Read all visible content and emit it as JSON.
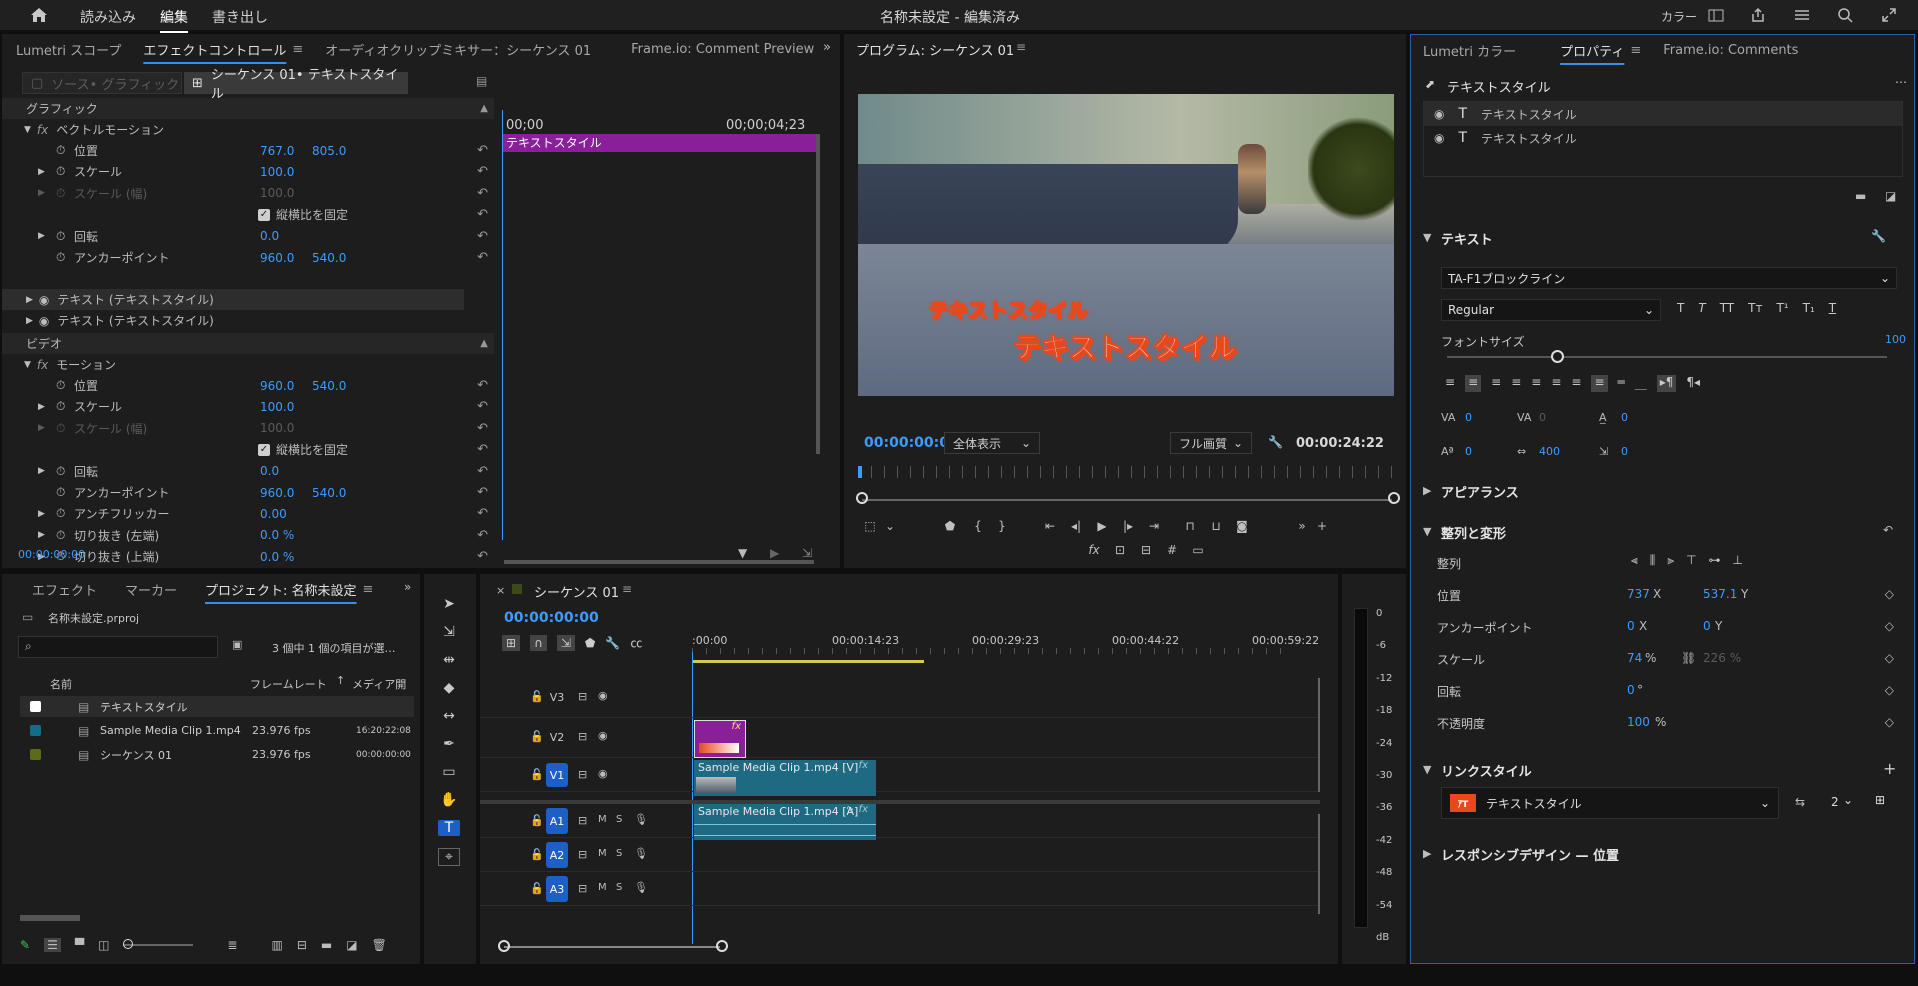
{
  "topbar": {
    "home_label": "",
    "menu": [
      "読み込み",
      "編集",
      "書き出し"
    ],
    "active_menu": 1,
    "title": "名称未設定 - 編集済み",
    "workspace_label": "カラー"
  },
  "effect_panel": {
    "tabs": [
      "Lumetri スコープ",
      "エフェクトコントロール",
      "オーディオクリップミキサー：シーケンス 01",
      "Frame.io: Comment Preview"
    ],
    "source_btn": "ソース• グラフィック",
    "sequence_btn": "シーケンス 01• テキストスタイル",
    "time_start": "00;00",
    "time_end": "00;00;04;23",
    "clip_label": "テキストスタイル",
    "timecode": "00:00:00:00",
    "graphic_header": "グラフィック",
    "vector_motion": "ベクトルモーション",
    "video_header": "ビデオ",
    "motion": "モーション",
    "params1": [
      {
        "label": "位置",
        "v1": "767.0",
        "v2": "805.0"
      },
      {
        "label": "スケール",
        "v1": "100.0"
      },
      {
        "label": "スケール (幅)",
        "v1": "100.0",
        "dim": true
      },
      {
        "label": "縦横比を固定",
        "check": true
      },
      {
        "label": "回転",
        "v1": "0.0"
      },
      {
        "label": "アンカーポイント",
        "v1": "960.0",
        "v2": "540.0"
      }
    ],
    "text_layers": [
      "テキスト (テキストスタイル)",
      "テキスト (テキストスタイル)"
    ],
    "params2": [
      {
        "label": "位置",
        "v1": "960.0",
        "v2": "540.0"
      },
      {
        "label": "スケール",
        "v1": "100.0"
      },
      {
        "label": "スケール (幅)",
        "v1": "100.0",
        "dim": true
      },
      {
        "label": "縦横比を固定",
        "check": true
      },
      {
        "label": "回転",
        "v1": "0.0"
      },
      {
        "label": "アンカーポイント",
        "v1": "960.0",
        "v2": "540.0"
      },
      {
        "label": "アンチフリッカー",
        "v1": "0.00"
      },
      {
        "label": "切り抜き (左端)",
        "v1": "0.0 %"
      },
      {
        "label": "切り抜き (上端)",
        "v1": "0.0 %"
      }
    ]
  },
  "program": {
    "title": "プログラム: シーケンス 01",
    "overlay1": "テキストスタイル",
    "overlay2": "テキストスタイル",
    "timecode": "00:00:00:00",
    "fit": "全体表示",
    "quality": "フル画質",
    "duration": "00:00:24:22"
  },
  "properties": {
    "tabs": [
      "Lumetri カラー",
      "プロパティ",
      "Frame.io: Comments"
    ],
    "header": "テキストスタイル",
    "layers": [
      "テキストスタイル",
      "テキストスタイル"
    ],
    "text_section": "テキスト",
    "font": "TA-F1ブロックライン",
    "style": "Regular",
    "font_size_label": "フォントサイズ",
    "font_size": "100",
    "kern": "0",
    "track": "0",
    "leading": "0",
    "baseline": "0",
    "tsume": "400",
    "extra": "0",
    "appearance": "アピアランス",
    "align_section": "整列と変形",
    "align_label": "整列",
    "position_label": "位置",
    "pos_x": "737",
    "pos_y": "537.1",
    "anchor_label": "アンカーポイント",
    "anchor_x": "0",
    "anchor_y": "0",
    "scale_label": "スケール",
    "scale": "74",
    "scale2": "226 %",
    "rotation_label": "回転",
    "rotation": "0",
    "opacity_label": "不透明度",
    "opacity": "100",
    "link_section": "リンクスタイル",
    "link_style": "テキストスタイル",
    "link_count": "2",
    "responsive": "レスポンシブデザイン — 位置"
  },
  "project": {
    "tabs": [
      "エフェクト",
      "マーカー",
      "プロジェクト: 名称未設定"
    ],
    "file": "名称未設定.prproj",
    "count": "3 個中 1 個の項目が選…",
    "col_name": "名前",
    "col_fps": "フレームレート",
    "col_media": "メディア開",
    "items": [
      {
        "name": "テキストスタイル",
        "fps": "",
        "media": "",
        "color": "#ffffff"
      },
      {
        "name": "Sample Media Clip 1.mp4",
        "fps": "23.976 fps",
        "media": "16:20:22:08",
        "color": "#0f6e8a"
      },
      {
        "name": "シーケンス 01",
        "fps": "23.976 fps",
        "media": "00:00:00:00",
        "color": "#5a6b1a"
      }
    ]
  },
  "timeline": {
    "title": "シーケンス 01",
    "timecode": "00:00:00:00",
    "ruler": [
      ":00:00",
      "00:00:14:23",
      "00:00:29:23",
      "00:00:44:22",
      "00:00:59:22"
    ],
    "tracks_v": [
      "V3",
      "V2",
      "V1"
    ],
    "tracks_a": [
      "A1",
      "A2",
      "A3"
    ],
    "clip_v": "Sample Media Clip 1.mp4 [V]",
    "clip_a": "Sample Media Clip 1.mp4 [A]",
    "fx": "fx"
  },
  "meter": {
    "ticks": [
      "0",
      "-6",
      "-12",
      "-18",
      "-24",
      "-30",
      "-36",
      "-42",
      "-48",
      "-54",
      "dB"
    ]
  }
}
